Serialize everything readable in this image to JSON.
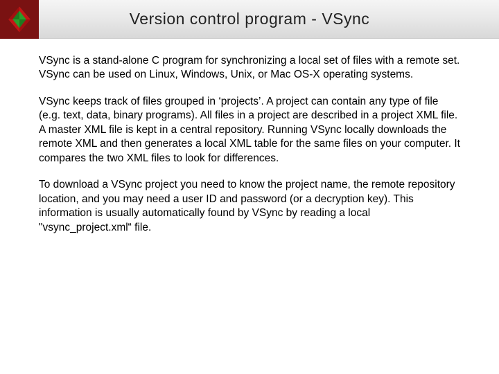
{
  "header": {
    "title": "Version control program - VSync"
  },
  "body": {
    "p1": "VSync is a stand-alone C program for synchronizing a local set of files with a remote set. VSync can be used on Linux, Windows, Unix, or Mac OS-X operating systems.",
    "p2": "VSync keeps track of files grouped in ‘projects’. A project can contain any type of file (e.g. text, data, binary programs). All files in a project are described in a project XML file. A master XML file is kept in a central repository.  Running VSync locally downloads the remote XML and then generates a local XML table for the same files on your computer. It compares the two XML files to look for differences.",
    "p3": "To download a VSync project you need to know the project name, the remote repository location, and you may need a user ID and password (or a decryption key). This information is usually automatically found by VSync by reading a local \"vsync_project.xml“ file."
  }
}
